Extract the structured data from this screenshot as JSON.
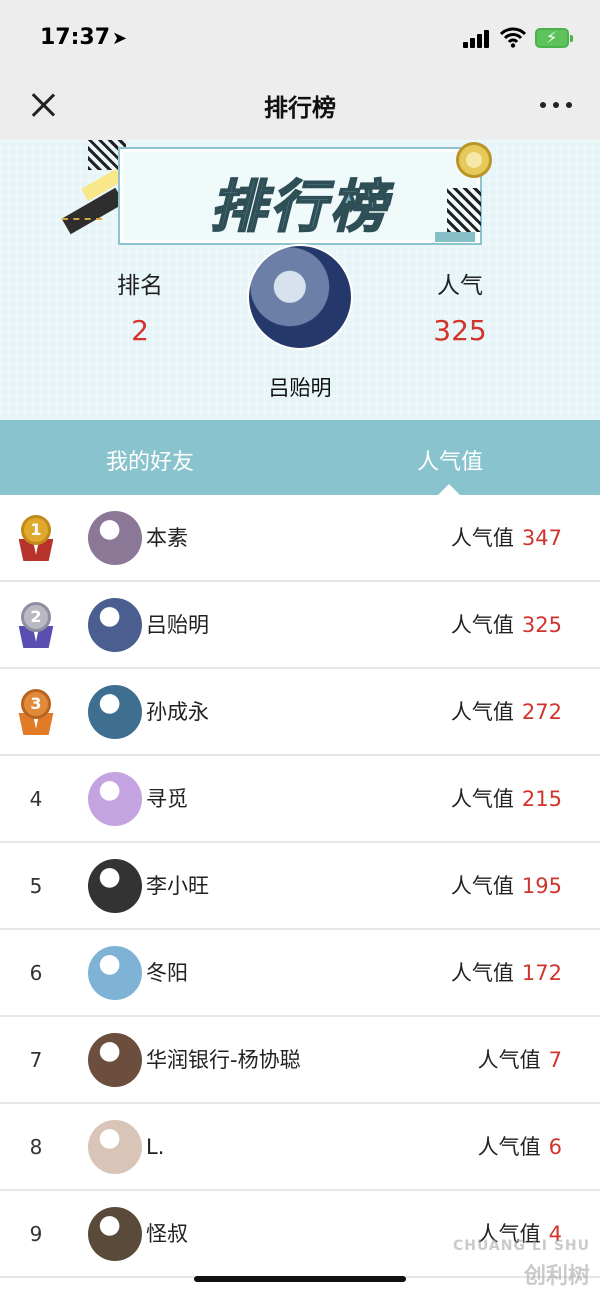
{
  "status_bar": {
    "time": "17:37"
  },
  "nav": {
    "title": "排行榜"
  },
  "header": {
    "banner_text": "排行榜",
    "rank_label": "排名",
    "rank_value": "2",
    "popularity_label": "人气",
    "popularity_value": "325",
    "user_name": "吕贻明"
  },
  "tabs": [
    {
      "label": "我的好友",
      "active": false
    },
    {
      "label": "人气值",
      "active": true
    }
  ],
  "list": [
    {
      "rank": "1",
      "badge": "gold",
      "name": "本素",
      "pop_label": "人气值",
      "pop_value": "347",
      "avatar_color": "#8a7896"
    },
    {
      "rank": "2",
      "badge": "silver",
      "name": "吕贻明",
      "pop_label": "人气值",
      "pop_value": "325",
      "avatar_color": "#4a5f8f"
    },
    {
      "rank": "3",
      "badge": "bronze",
      "name": "孙成永",
      "pop_label": "人气值",
      "pop_value": "272",
      "avatar_color": "#3e6e90"
    },
    {
      "rank": "4",
      "badge": "",
      "name": "寻觅",
      "pop_label": "人气值",
      "pop_value": "215",
      "avatar_color": "#c4a3e0"
    },
    {
      "rank": "5",
      "badge": "",
      "name": "李小旺",
      "pop_label": "人气值",
      "pop_value": "195",
      "avatar_color": "#333333"
    },
    {
      "rank": "6",
      "badge": "",
      "name": "冬阳",
      "pop_label": "人气值",
      "pop_value": "172",
      "avatar_color": "#7fb3d6"
    },
    {
      "rank": "7",
      "badge": "",
      "name": "华润银行-杨协聪",
      "pop_label": "人气值",
      "pop_value": "7",
      "avatar_color": "#6b4e3e"
    },
    {
      "rank": "8",
      "badge": "",
      "name": "L.",
      "pop_label": "人气值",
      "pop_value": "6",
      "avatar_color": "#d9c4b8"
    },
    {
      "rank": "9",
      "badge": "",
      "name": "怪叔",
      "pop_label": "人气值",
      "pop_value": "4",
      "avatar_color": "#5a4a3a"
    }
  ],
  "watermark": {
    "line1": "CHUANG LI SHU",
    "line2": "创利树"
  },
  "colors": {
    "accent_red": "#d0342c",
    "tab_bg": "#89c3ce",
    "header_bg": "#e7f4f8"
  }
}
